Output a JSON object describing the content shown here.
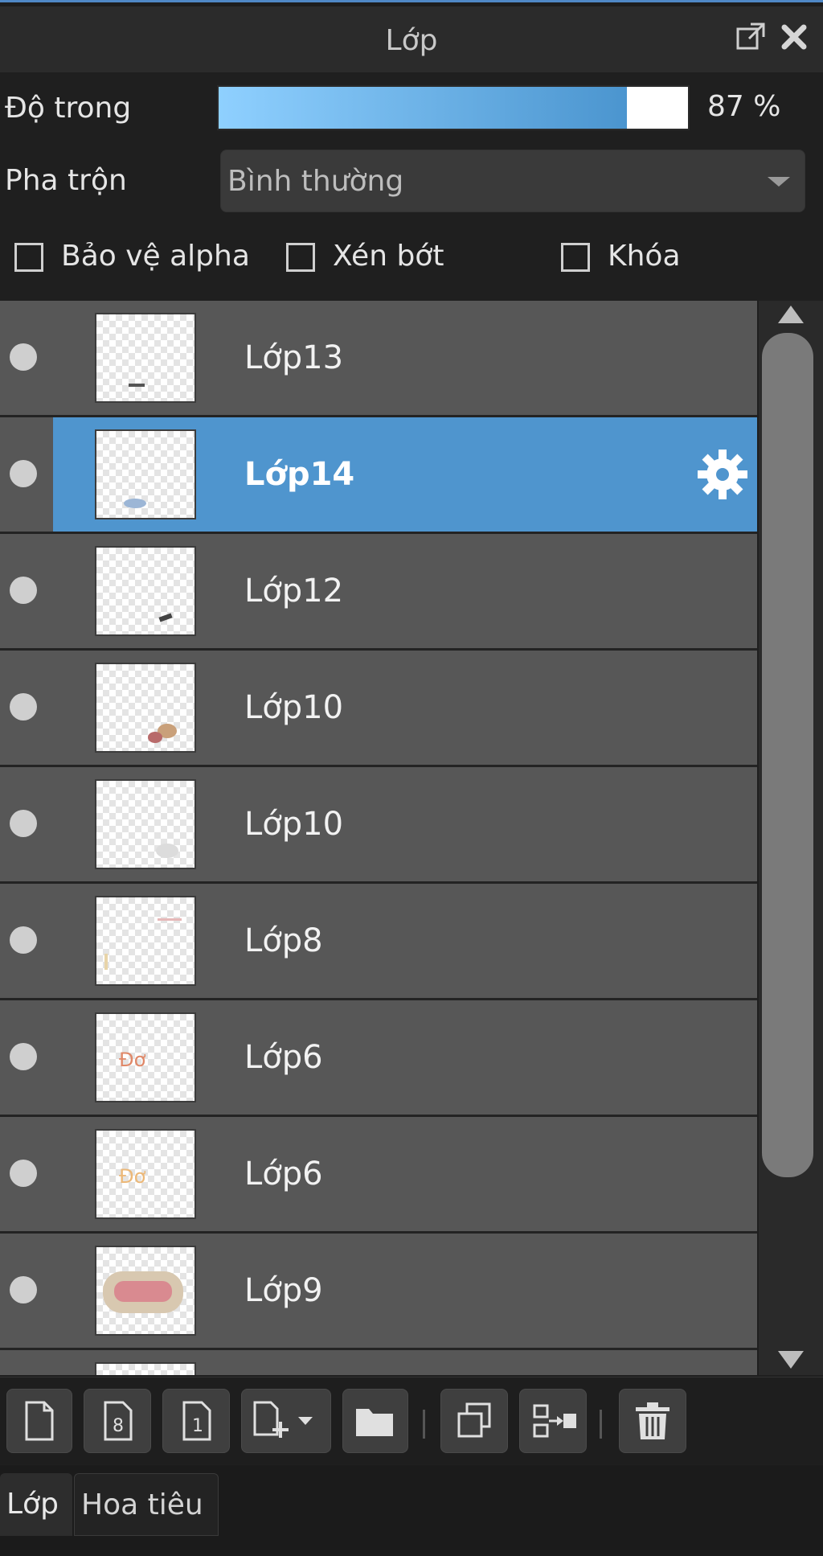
{
  "panel": {
    "title": "Lớp"
  },
  "opacity": {
    "label": "Độ trong",
    "value": 87,
    "display": "87 %"
  },
  "blend": {
    "label": "Pha trộn",
    "value": "Bình thường"
  },
  "checkboxes": [
    {
      "label": "Bảo vệ alpha",
      "checked": false
    },
    {
      "label": "Xén bớt",
      "checked": false
    },
    {
      "label": "Khóa",
      "checked": false
    }
  ],
  "layers": [
    {
      "name": "Lớp13",
      "selected": false
    },
    {
      "name": "Lớp14",
      "selected": true
    },
    {
      "name": "Lớp12",
      "selected": false
    },
    {
      "name": "Lớp10",
      "selected": false
    },
    {
      "name": "Lớp10",
      "selected": false
    },
    {
      "name": "Lớp8",
      "selected": false
    },
    {
      "name": "Lớp6",
      "selected": false
    },
    {
      "name": "Lớp6",
      "selected": false
    },
    {
      "name": "Lớp9",
      "selected": false
    }
  ],
  "toolbar": {
    "buttons": [
      {
        "icon": "new-layer-icon"
      },
      {
        "icon": "new-8bit-layer-icon"
      },
      {
        "icon": "new-1bit-layer-icon"
      },
      {
        "icon": "add-layer-dropdown-icon"
      },
      {
        "icon": "folder-icon"
      },
      {
        "icon": "duplicate-layer-icon"
      },
      {
        "icon": "merge-down-icon"
      },
      {
        "icon": "trash-icon"
      }
    ]
  },
  "tabs": [
    {
      "label": "Lớp",
      "active": true
    },
    {
      "label": "Hoa tiêu",
      "active": false
    }
  ]
}
